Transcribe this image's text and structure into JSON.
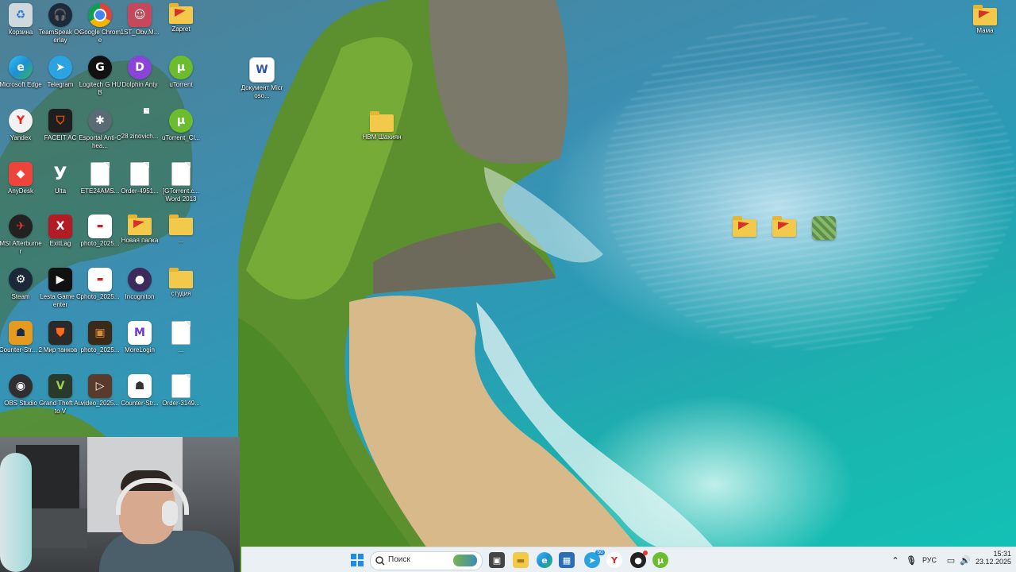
{
  "desktop": {
    "icons": [
      {
        "label": "Корзина",
        "icon": "recycle-bin-icon",
        "color": "#cfd8dc"
      },
      {
        "label": "TeamSpeak Overlay",
        "icon": "teamspeak-icon",
        "color": "#1c2a3a"
      },
      {
        "label": "Google Chrome",
        "icon": "chrome-icon",
        "color": "#db4437"
      },
      {
        "label": "1ST_Obv.M...",
        "icon": "image-thumbnail-icon",
        "color": "#c7485a"
      },
      {
        "label": "Zapret",
        "icon": "folder-icon",
        "color": "#f3c94b"
      },
      {
        "label": "Microsoft Edge",
        "icon": "edge-icon",
        "color": "#1e8fd6"
      },
      {
        "label": "Telegram",
        "icon": "telegram-icon",
        "color": "#2aa3e0"
      },
      {
        "label": "Logitech G HUB",
        "icon": "logitech-icon",
        "color": "#111111"
      },
      {
        "label": "Dolphin Anty",
        "icon": "dolphin-icon",
        "color": "#8a44d8"
      },
      {
        "label": "uTorrent",
        "icon": "utorrent-icon",
        "color": "#6bbd2e"
      },
      {
        "label": "Документ Microso...",
        "icon": "word-document-icon",
        "color": "#2b579a"
      },
      {
        "label": "Yandex",
        "icon": "yandex-browser-icon",
        "color": "#f2f2f2"
      },
      {
        "label": "FACEIT AC",
        "icon": "faceit-icon",
        "color": "#1f1f1f"
      },
      {
        "label": "Esportal Anti-Chea...",
        "icon": "esportal-icon",
        "color": "#5b6b73"
      },
      {
        "label": "28 zinovich...",
        "icon": "file-icon",
        "color": "#cfcfcf"
      },
      {
        "label": "uTorrent_Cl...",
        "icon": "utorrent-icon",
        "color": "#6bbd2e"
      },
      {
        "label": "HBM Шахиян",
        "icon": "folder-icon",
        "color": "#f3c94b"
      },
      {
        "label": "AnyDesk",
        "icon": "anydesk-icon",
        "color": "#ef443b"
      },
      {
        "label": "Ulta",
        "icon": "ulta-icon",
        "color": "#1d1d1d"
      },
      {
        "label": "ETE24AMS...",
        "icon": "file-icon",
        "color": "#ffffff"
      },
      {
        "label": "Order-4951...",
        "icon": "file-icon",
        "color": "#ffffff"
      },
      {
        "label": "[GTorrent.c... Word 2013",
        "icon": "torrent-file-icon",
        "color": "#ffffff"
      },
      {
        "label": "MSI Afterburner",
        "icon": "msi-afterburner-icon",
        "color": "#222222"
      },
      {
        "label": "ExitLag",
        "icon": "exitlag-icon",
        "color": "#b31b25"
      },
      {
        "label": "photo_2025...",
        "icon": "image-thumbnail-icon",
        "color": "#ffffff"
      },
      {
        "label": "Новая папка",
        "icon": "folder-icon",
        "color": "#f3c94b"
      },
      {
        "label": "...",
        "icon": "folder-icon",
        "color": "#f3c94b"
      },
      {
        "label": "Steam",
        "icon": "steam-icon",
        "color": "#1b2838"
      },
      {
        "label": "Lesta Game Center",
        "icon": "lesta-icon",
        "color": "#111111"
      },
      {
        "label": "photo_2025...",
        "icon": "image-thumbnail-icon",
        "color": "#ffffff"
      },
      {
        "label": "Incogniton",
        "icon": "incogniton-icon",
        "color": "#3b2a5a"
      },
      {
        "label": "студия",
        "icon": "folder-icon",
        "color": "#f3c94b"
      },
      {
        "label": "Counter-Str... 2",
        "icon": "counter-strike-icon",
        "color": "#e59b1e"
      },
      {
        "label": "Мир танков",
        "icon": "mir-tankov-icon",
        "color": "#2a2a2a"
      },
      {
        "label": "photo_2025...",
        "icon": "image-thumbnail-icon",
        "color": "#3a2a1a"
      },
      {
        "label": "MoreLogin",
        "icon": "morelogin-icon",
        "color": "#ffffff"
      },
      {
        "label": "...",
        "icon": "file-icon",
        "color": "#ffffff"
      },
      {
        "label": "OBS Studio",
        "icon": "obs-icon",
        "color": "#302e31"
      },
      {
        "label": "Grand Theft Auto V",
        "icon": "gta-icon",
        "color": "#2a3a2a"
      },
      {
        "label": "video_2025...",
        "icon": "video-thumbnail-icon",
        "color": "#5a3a2a"
      },
      {
        "label": "Counter-Str...",
        "icon": "counter-strike-icon",
        "color": "#ffffff"
      },
      {
        "label": "Order-3149...",
        "icon": "file-icon",
        "color": "#ffffff"
      },
      {
        "label": "Мама",
        "icon": "folder-icon",
        "color": "#f3c94b"
      }
    ]
  },
  "taskbar": {
    "search_placeholder": "Поиск",
    "language": "РУС",
    "time": "15:31",
    "date": "23.12.2025",
    "telegram_badge": "50"
  }
}
